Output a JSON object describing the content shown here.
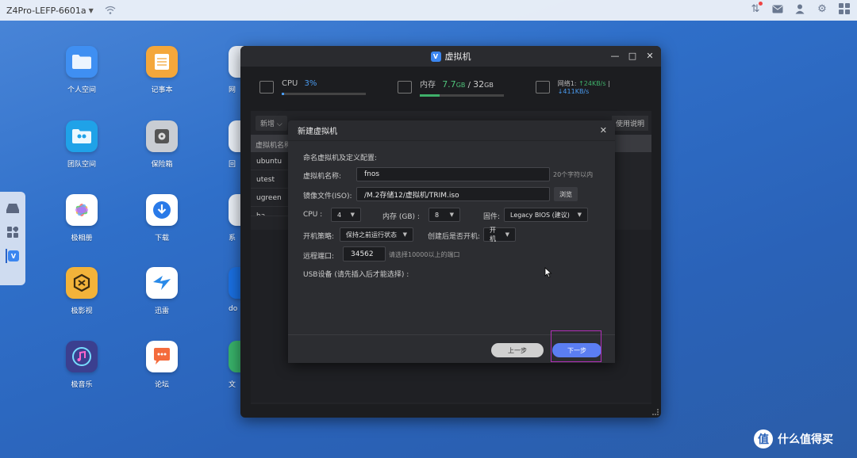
{
  "topbar": {
    "hostname": "Z4Pro-LEFP-6601a",
    "icons": [
      "upload-download-icon",
      "mail-icon",
      "user-icon",
      "gear-icon",
      "grid-icon"
    ]
  },
  "desktop": {
    "apps": [
      {
        "label": "个人空间",
        "icon": "folder-icon",
        "color": "#3f8ff2"
      },
      {
        "label": "记事本",
        "icon": "notepad-icon",
        "color": "#f4a73b"
      },
      {
        "label": "网",
        "icon": "network-icon",
        "color": "#e9eef5"
      },
      {
        "label": "团队空间",
        "icon": "team-folder-icon",
        "color": "#1fa2e8"
      },
      {
        "label": "保险箱",
        "icon": "safe-icon",
        "color": "#c9cdd3"
      },
      {
        "label": "回",
        "icon": "recycle-icon",
        "color": "#e9eef5"
      },
      {
        "label": "极相册",
        "icon": "photos-icon",
        "color": "#ffffff"
      },
      {
        "label": "下载",
        "icon": "download-icon",
        "color": "#ffffff"
      },
      {
        "label": "系",
        "icon": "system-icon",
        "color": "#e9eef5"
      },
      {
        "label": "极影视",
        "icon": "video-icon",
        "color": "#f2b33a"
      },
      {
        "label": "迅雷",
        "icon": "thunder-icon",
        "color": "#ffffff"
      },
      {
        "label": "do",
        "icon": "docker-icon",
        "color": "#1a6fe0"
      },
      {
        "label": "极音乐",
        "icon": "music-icon",
        "color": "#3b3f8f"
      },
      {
        "label": "论坛",
        "icon": "forum-icon",
        "color": "#ffffff"
      },
      {
        "label": "文",
        "icon": "file-icon",
        "color": "#38b26a"
      }
    ]
  },
  "vm_window": {
    "title": "虚拟机",
    "logo_text": "V",
    "minimize": "—",
    "maximize": "□",
    "close": "✕",
    "cpu": {
      "label": "CPU",
      "value": "3%",
      "level": 0.03
    },
    "memory": {
      "label": "内存",
      "used": "7.7",
      "used_unit": "GB",
      "sep": "/",
      "total": "32",
      "total_unit": "GB",
      "level": 0.24
    },
    "network": {
      "label": "网络1:",
      "up": "↑24KB/s",
      "sep": "|",
      "down": "↓411KB/s"
    },
    "toolbar": {
      "new_label": "新增 ⌵",
      "help_label": "使用说明"
    },
    "list": {
      "header": "虚拟机名称",
      "items": [
        "ubuntu",
        "utest",
        "ugreen",
        "ha"
      ]
    }
  },
  "dialog": {
    "title": "新建虚拟机",
    "close": "✕",
    "section": "命名虚拟机及定义配置:",
    "name": {
      "label": "虚拟机名称:",
      "value": "fnos",
      "hint": "20个字符以内"
    },
    "iso": {
      "label": "镜像文件(ISO):",
      "value": "/M.2存储12/虚拟机/TRIM.iso",
      "browse": "浏览"
    },
    "cpu": {
      "label": "CPU :",
      "value": "4"
    },
    "memory": {
      "label": "内存 (GB) :",
      "value": "8"
    },
    "firmware": {
      "label": "固件:",
      "value": "Legacy BIOS (建议)"
    },
    "boot_policy": {
      "label": "开机策略:",
      "value": "保持之前运行状态"
    },
    "power_on": {
      "label": "创建后是否开机:",
      "value": "开机"
    },
    "remote_port": {
      "label": "远程端口:",
      "value": "34562",
      "hint": "请选择10000以上的端口"
    },
    "usb": {
      "label": "USB设备 (请先插入后才能选择) :"
    },
    "prev": "上一步",
    "next": "下一步"
  },
  "watermark": {
    "logo": "值",
    "text": "什么值得买"
  }
}
